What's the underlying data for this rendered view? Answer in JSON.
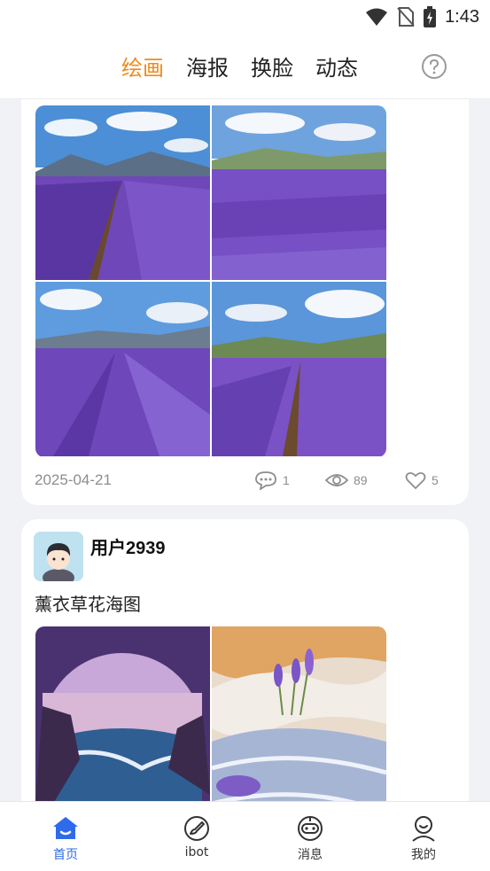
{
  "status_bar": {
    "time": "1:43",
    "icons": [
      "wifi-icon",
      "no-sim-icon",
      "battery-charging-icon"
    ]
  },
  "header": {
    "tabs": [
      {
        "label": "绘画",
        "active": true
      },
      {
        "label": "海报",
        "active": false
      },
      {
        "label": "换脸",
        "active": false
      },
      {
        "label": "动态",
        "active": false
      }
    ],
    "help_icon": "question-circle-icon"
  },
  "posts": [
    {
      "date": "2025-04-21",
      "comments": "1",
      "views": "89",
      "likes": "5",
      "images": [
        "lavender-field-1",
        "lavender-field-2",
        "lavender-field-3",
        "lavender-field-4"
      ]
    },
    {
      "username": "用户2939",
      "title": "薰衣草花海图",
      "images": [
        "lavender-ocean-art",
        "lavender-wave-art"
      ]
    }
  ],
  "bottom_nav": [
    {
      "label": "首页",
      "icon": "home-icon",
      "active": true
    },
    {
      "label": "ibot",
      "icon": "brush-icon",
      "active": false
    },
    {
      "label": "消息",
      "icon": "robot-chat-icon",
      "active": false
    },
    {
      "label": "我的",
      "icon": "user-icon",
      "active": false
    }
  ],
  "colors": {
    "accent_orange": "#f08a1c",
    "nav_active_blue": "#2e6bea",
    "lavender": "#7b4fc9"
  }
}
